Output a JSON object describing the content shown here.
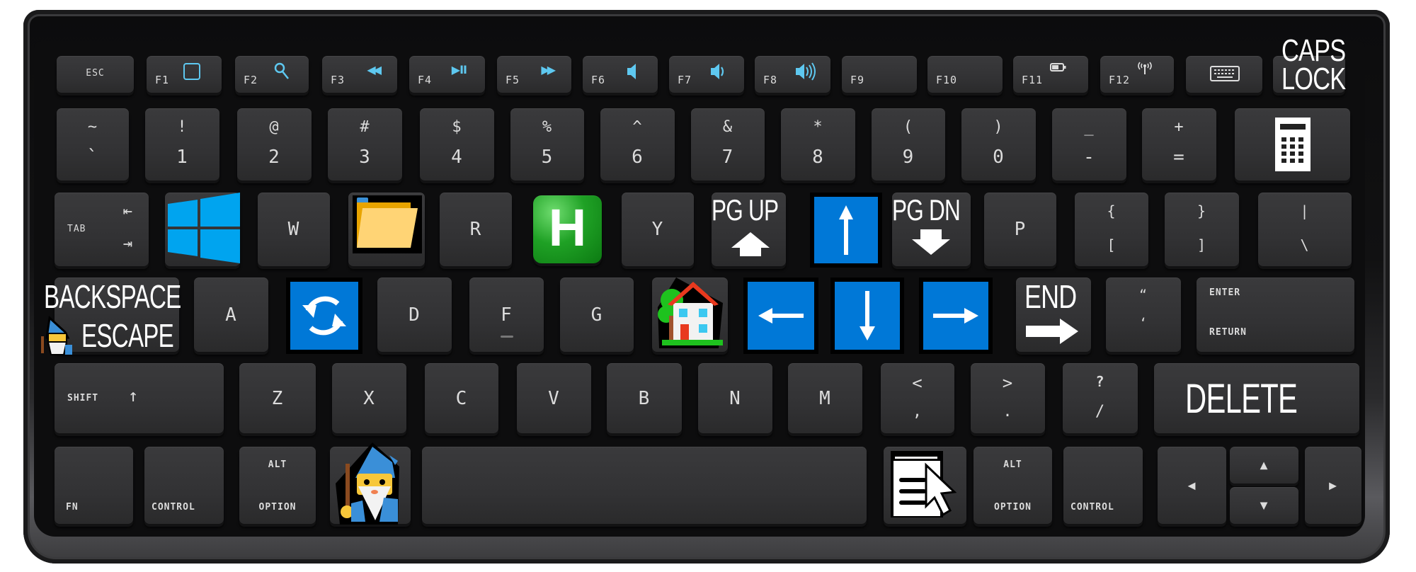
{
  "keyboard": {
    "function_row": [
      {
        "id": "esc",
        "label": "ESC"
      },
      {
        "id": "f1",
        "label": "F1",
        "icon": "window-icon"
      },
      {
        "id": "f2",
        "label": "F2",
        "icon": "search-icon"
      },
      {
        "id": "f3",
        "label": "F3",
        "icon": "rewind-icon",
        "glyph": "◀◀"
      },
      {
        "id": "f4",
        "label": "F4",
        "icon": "play-pause-icon",
        "glyph": "▶II"
      },
      {
        "id": "f5",
        "label": "F5",
        "icon": "fast-forward-icon",
        "glyph": "▶▶"
      },
      {
        "id": "f6",
        "label": "F6",
        "icon": "volume-mute-icon"
      },
      {
        "id": "f7",
        "label": "F7",
        "icon": "volume-down-icon"
      },
      {
        "id": "f8",
        "label": "F8",
        "icon": "volume-up-icon"
      },
      {
        "id": "f9",
        "label": "F9"
      },
      {
        "id": "f10",
        "label": "F10"
      },
      {
        "id": "f11",
        "label": "F11",
        "icon": "battery-icon"
      },
      {
        "id": "f12",
        "label": "F12",
        "icon": "wireless-icon",
        "glyph": "((ı))"
      },
      {
        "id": "keyboard",
        "label": "",
        "icon": "keyboard-icon"
      }
    ],
    "caps_lock_overlay": [
      "CAPS",
      "LOCK"
    ],
    "number_row": [
      {
        "top": "~",
        "bottom": "`"
      },
      {
        "top": "!",
        "bottom": "1"
      },
      {
        "top": "@",
        "bottom": "2"
      },
      {
        "top": "#",
        "bottom": "3"
      },
      {
        "top": "$",
        "bottom": "4"
      },
      {
        "top": "%",
        "bottom": "5"
      },
      {
        "top": "^",
        "bottom": "6"
      },
      {
        "top": "&",
        "bottom": "7"
      },
      {
        "top": "*",
        "bottom": "8"
      },
      {
        "top": "(",
        "bottom": "9"
      },
      {
        "top": ")",
        "bottom": "0"
      },
      {
        "top": "_",
        "bottom": "-"
      },
      {
        "top": "+",
        "bottom": "="
      }
    ],
    "calculator_icon": "calculator-icon",
    "qwerty_row": {
      "tab": "TAB",
      "tab_arrows": [
        "⇤",
        "⇥"
      ],
      "w": "W",
      "r": "R",
      "y": "Y",
      "p": "P",
      "bracket_open": {
        "top": "{",
        "bottom": "["
      },
      "bracket_close": {
        "top": "}",
        "bottom": "]"
      },
      "backslash": {
        "top": "|",
        "bottom": "\\"
      },
      "pg_up": "PG UP",
      "pg_dn": "PG DN",
      "arrow_up": "↑",
      "h_letter": "H"
    },
    "home_row": {
      "backspace_overlay": "BACKSPACE",
      "escape_overlay": "ESCAPE",
      "a": "A",
      "d": "D",
      "f": "F",
      "g": "G",
      "arrow_left": "←",
      "arrow_down": "↓",
      "arrow_right": "→",
      "end": "END",
      "end_arrow": "➡",
      "quote": {
        "top": "“",
        "bottom": "‘"
      },
      "enter": "ENTER",
      "return": "RETURN"
    },
    "shift_row": {
      "shift": "SHIFT",
      "shift_arrow": "↑",
      "letters": [
        "Z",
        "X",
        "C",
        "V",
        "B",
        "N",
        "M"
      ],
      "comma": {
        "top": "<",
        "bottom": ","
      },
      "period": {
        "top": ">",
        "bottom": "."
      },
      "slash": {
        "top": "?",
        "bottom": "/"
      },
      "delete": "DELETE"
    },
    "bottom_row": {
      "fn": "FN",
      "control": "CONTROL",
      "alt": "ALT",
      "option": "OPTION",
      "alt_r": "ALT",
      "option_r": "OPTION",
      "control_r": "CONTROL",
      "arrow_left": "◀",
      "arrow_up": "▲",
      "arrow_down": "▼",
      "arrow_right": "▶"
    }
  },
  "colors": {
    "accent_blue": "#0078d7",
    "fn_icon": "#5ec8f0",
    "h_green": "#1fa125",
    "win_blue": "#00a4ef",
    "folder": "#ffd475"
  }
}
